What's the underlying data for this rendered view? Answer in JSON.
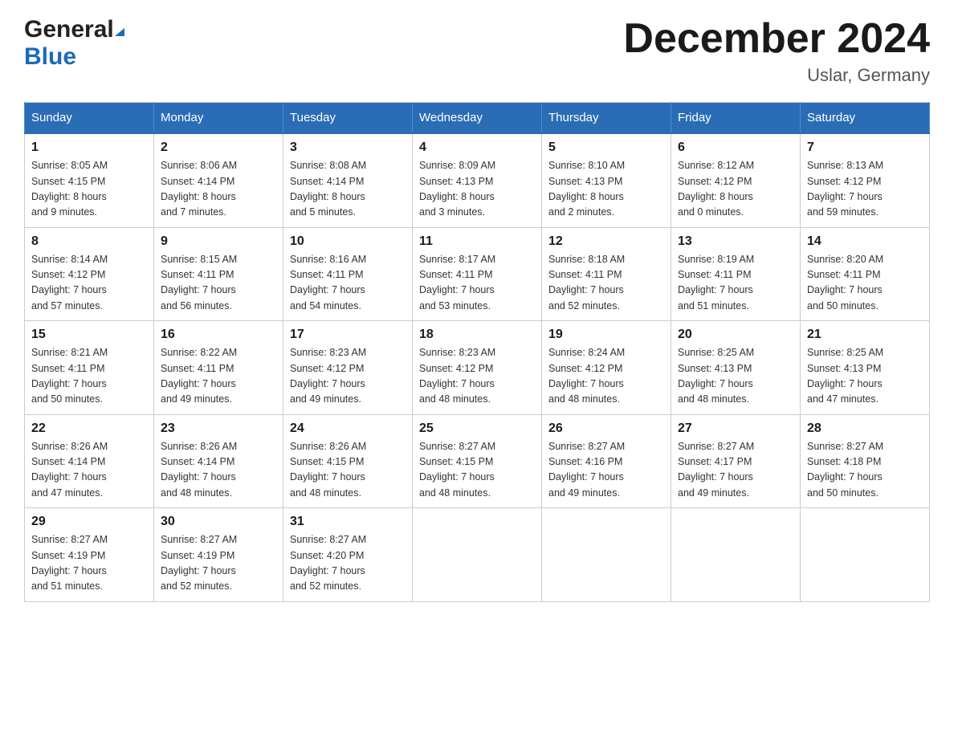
{
  "header": {
    "logo_general": "General",
    "logo_blue": "Blue",
    "title": "December 2024",
    "location": "Uslar, Germany"
  },
  "days_of_week": [
    "Sunday",
    "Monday",
    "Tuesday",
    "Wednesday",
    "Thursday",
    "Friday",
    "Saturday"
  ],
  "weeks": [
    [
      {
        "day": "1",
        "sunrise": "Sunrise: 8:05 AM",
        "sunset": "Sunset: 4:15 PM",
        "daylight": "Daylight: 8 hours",
        "daylight2": "and 9 minutes."
      },
      {
        "day": "2",
        "sunrise": "Sunrise: 8:06 AM",
        "sunset": "Sunset: 4:14 PM",
        "daylight": "Daylight: 8 hours",
        "daylight2": "and 7 minutes."
      },
      {
        "day": "3",
        "sunrise": "Sunrise: 8:08 AM",
        "sunset": "Sunset: 4:14 PM",
        "daylight": "Daylight: 8 hours",
        "daylight2": "and 5 minutes."
      },
      {
        "day": "4",
        "sunrise": "Sunrise: 8:09 AM",
        "sunset": "Sunset: 4:13 PM",
        "daylight": "Daylight: 8 hours",
        "daylight2": "and 3 minutes."
      },
      {
        "day": "5",
        "sunrise": "Sunrise: 8:10 AM",
        "sunset": "Sunset: 4:13 PM",
        "daylight": "Daylight: 8 hours",
        "daylight2": "and 2 minutes."
      },
      {
        "day": "6",
        "sunrise": "Sunrise: 8:12 AM",
        "sunset": "Sunset: 4:12 PM",
        "daylight": "Daylight: 8 hours",
        "daylight2": "and 0 minutes."
      },
      {
        "day": "7",
        "sunrise": "Sunrise: 8:13 AM",
        "sunset": "Sunset: 4:12 PM",
        "daylight": "Daylight: 7 hours",
        "daylight2": "and 59 minutes."
      }
    ],
    [
      {
        "day": "8",
        "sunrise": "Sunrise: 8:14 AM",
        "sunset": "Sunset: 4:12 PM",
        "daylight": "Daylight: 7 hours",
        "daylight2": "and 57 minutes."
      },
      {
        "day": "9",
        "sunrise": "Sunrise: 8:15 AM",
        "sunset": "Sunset: 4:11 PM",
        "daylight": "Daylight: 7 hours",
        "daylight2": "and 56 minutes."
      },
      {
        "day": "10",
        "sunrise": "Sunrise: 8:16 AM",
        "sunset": "Sunset: 4:11 PM",
        "daylight": "Daylight: 7 hours",
        "daylight2": "and 54 minutes."
      },
      {
        "day": "11",
        "sunrise": "Sunrise: 8:17 AM",
        "sunset": "Sunset: 4:11 PM",
        "daylight": "Daylight: 7 hours",
        "daylight2": "and 53 minutes."
      },
      {
        "day": "12",
        "sunrise": "Sunrise: 8:18 AM",
        "sunset": "Sunset: 4:11 PM",
        "daylight": "Daylight: 7 hours",
        "daylight2": "and 52 minutes."
      },
      {
        "day": "13",
        "sunrise": "Sunrise: 8:19 AM",
        "sunset": "Sunset: 4:11 PM",
        "daylight": "Daylight: 7 hours",
        "daylight2": "and 51 minutes."
      },
      {
        "day": "14",
        "sunrise": "Sunrise: 8:20 AM",
        "sunset": "Sunset: 4:11 PM",
        "daylight": "Daylight: 7 hours",
        "daylight2": "and 50 minutes."
      }
    ],
    [
      {
        "day": "15",
        "sunrise": "Sunrise: 8:21 AM",
        "sunset": "Sunset: 4:11 PM",
        "daylight": "Daylight: 7 hours",
        "daylight2": "and 50 minutes."
      },
      {
        "day": "16",
        "sunrise": "Sunrise: 8:22 AM",
        "sunset": "Sunset: 4:11 PM",
        "daylight": "Daylight: 7 hours",
        "daylight2": "and 49 minutes."
      },
      {
        "day": "17",
        "sunrise": "Sunrise: 8:23 AM",
        "sunset": "Sunset: 4:12 PM",
        "daylight": "Daylight: 7 hours",
        "daylight2": "and 49 minutes."
      },
      {
        "day": "18",
        "sunrise": "Sunrise: 8:23 AM",
        "sunset": "Sunset: 4:12 PM",
        "daylight": "Daylight: 7 hours",
        "daylight2": "and 48 minutes."
      },
      {
        "day": "19",
        "sunrise": "Sunrise: 8:24 AM",
        "sunset": "Sunset: 4:12 PM",
        "daylight": "Daylight: 7 hours",
        "daylight2": "and 48 minutes."
      },
      {
        "day": "20",
        "sunrise": "Sunrise: 8:25 AM",
        "sunset": "Sunset: 4:13 PM",
        "daylight": "Daylight: 7 hours",
        "daylight2": "and 48 minutes."
      },
      {
        "day": "21",
        "sunrise": "Sunrise: 8:25 AM",
        "sunset": "Sunset: 4:13 PM",
        "daylight": "Daylight: 7 hours",
        "daylight2": "and 47 minutes."
      }
    ],
    [
      {
        "day": "22",
        "sunrise": "Sunrise: 8:26 AM",
        "sunset": "Sunset: 4:14 PM",
        "daylight": "Daylight: 7 hours",
        "daylight2": "and 47 minutes."
      },
      {
        "day": "23",
        "sunrise": "Sunrise: 8:26 AM",
        "sunset": "Sunset: 4:14 PM",
        "daylight": "Daylight: 7 hours",
        "daylight2": "and 48 minutes."
      },
      {
        "day": "24",
        "sunrise": "Sunrise: 8:26 AM",
        "sunset": "Sunset: 4:15 PM",
        "daylight": "Daylight: 7 hours",
        "daylight2": "and 48 minutes."
      },
      {
        "day": "25",
        "sunrise": "Sunrise: 8:27 AM",
        "sunset": "Sunset: 4:15 PM",
        "daylight": "Daylight: 7 hours",
        "daylight2": "and 48 minutes."
      },
      {
        "day": "26",
        "sunrise": "Sunrise: 8:27 AM",
        "sunset": "Sunset: 4:16 PM",
        "daylight": "Daylight: 7 hours",
        "daylight2": "and 49 minutes."
      },
      {
        "day": "27",
        "sunrise": "Sunrise: 8:27 AM",
        "sunset": "Sunset: 4:17 PM",
        "daylight": "Daylight: 7 hours",
        "daylight2": "and 49 minutes."
      },
      {
        "day": "28",
        "sunrise": "Sunrise: 8:27 AM",
        "sunset": "Sunset: 4:18 PM",
        "daylight": "Daylight: 7 hours",
        "daylight2": "and 50 minutes."
      }
    ],
    [
      {
        "day": "29",
        "sunrise": "Sunrise: 8:27 AM",
        "sunset": "Sunset: 4:19 PM",
        "daylight": "Daylight: 7 hours",
        "daylight2": "and 51 minutes."
      },
      {
        "day": "30",
        "sunrise": "Sunrise: 8:27 AM",
        "sunset": "Sunset: 4:19 PM",
        "daylight": "Daylight: 7 hours",
        "daylight2": "and 52 minutes."
      },
      {
        "day": "31",
        "sunrise": "Sunrise: 8:27 AM",
        "sunset": "Sunset: 4:20 PM",
        "daylight": "Daylight: 7 hours",
        "daylight2": "and 52 minutes."
      },
      null,
      null,
      null,
      null
    ]
  ]
}
